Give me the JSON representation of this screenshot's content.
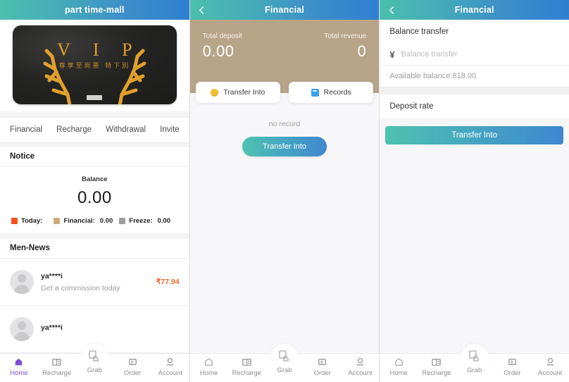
{
  "panels": [
    {
      "header": {
        "title": "part time-mall",
        "has_back": false
      },
      "banner": {
        "vip_text": "V I P",
        "vip_sub": "尊享至尚悪 特下別",
        "alt": "vip-banner"
      },
      "tabs": [
        {
          "label": "Financial"
        },
        {
          "label": "Recharge"
        },
        {
          "label": "Withdrawal"
        },
        {
          "label": "Invite"
        }
      ],
      "notice_heading": "Notice",
      "balance": {
        "label": "Balance",
        "value": "0.00",
        "legend": [
          {
            "label": "Today:",
            "value": "",
            "color": "#f4511e"
          },
          {
            "label": "Financial:",
            "value": "0.00",
            "color": "#cdab7b"
          },
          {
            "label": "Freeze:",
            "value": "0.00",
            "color": "#9e9e9e"
          }
        ]
      },
      "news_heading": "Men-News",
      "news": [
        {
          "name": "ya****i",
          "desc": "Get a commission today",
          "amount": "₹77.94"
        },
        {
          "name": "ya****i",
          "desc": "",
          "amount": ""
        }
      ]
    },
    {
      "header": {
        "title": "Financial",
        "has_back": true
      },
      "stats": [
        {
          "label": "Total deposit",
          "value": "0.00"
        },
        {
          "label": "Total revenue",
          "value": "0"
        }
      ],
      "tabs": [
        {
          "label": "Transfer Into",
          "icon": "coin-icon"
        },
        {
          "label": "Records",
          "icon": "records-icon"
        }
      ],
      "empty_text": "no record",
      "action_button": "Transfer Into"
    },
    {
      "header": {
        "title": "Financial",
        "has_back": true
      },
      "form_label": "Balance transfer",
      "input": {
        "value": "",
        "placeholder": "Balance transfer",
        "currency": "¥"
      },
      "available_balance": "Available balance:818.00",
      "deposit_rate_label": "Deposit rate",
      "action_button": "Transfer Into"
    }
  ],
  "tabbar": {
    "items": [
      {
        "label": "Home",
        "icon": "home-icon"
      },
      {
        "label": "Recharge",
        "icon": "recharge-icon"
      },
      {
        "label": "Grab",
        "icon": "grab-icon"
      },
      {
        "label": "Order",
        "icon": "order-icon"
      },
      {
        "label": "Account",
        "icon": "account-icon"
      }
    ],
    "active_index_panel1": 0
  },
  "theme": {
    "gradient_start": "#4cbfae",
    "gradient_end": "#2f7fd0",
    "header_tan": "#b8a488",
    "accent_orange": "#e8682b",
    "active_purple": "#7d4fd6"
  }
}
